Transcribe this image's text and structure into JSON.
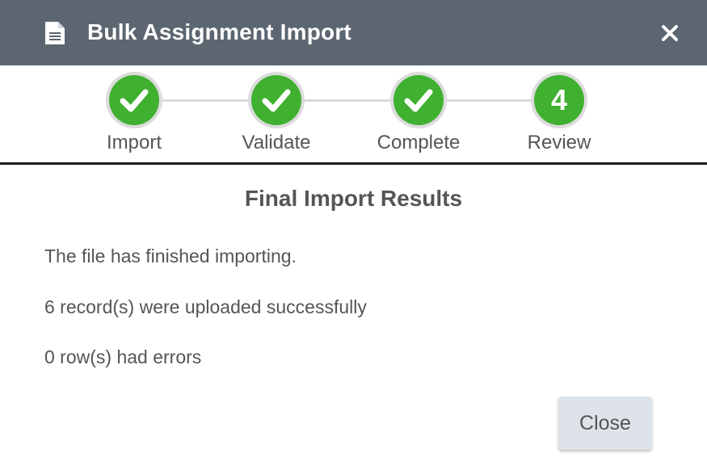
{
  "dialog": {
    "title": "Bulk Assignment Import",
    "header_icon": "document-icon",
    "close_icon": "close-icon",
    "header_color": "#5b6670"
  },
  "stepper": {
    "accent_color": "#3fb02f",
    "steps": [
      {
        "label": "Import",
        "state": "completed",
        "icon": "checkmark-icon"
      },
      {
        "label": "Validate",
        "state": "completed",
        "icon": "checkmark-icon"
      },
      {
        "label": "Complete",
        "state": "completed",
        "icon": "checkmark-icon"
      },
      {
        "label": "Review",
        "state": "current",
        "number": "4"
      }
    ]
  },
  "results": {
    "title": "Final Import Results",
    "lines": [
      "The file has finished importing.",
      "6 record(s) were uploaded successfully",
      "0 row(s) had errors"
    ]
  },
  "footer": {
    "close_label": "Close"
  }
}
